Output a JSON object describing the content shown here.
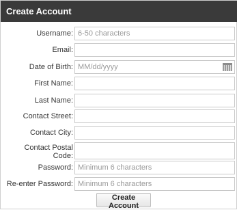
{
  "form": {
    "title": "Create Account",
    "fields": {
      "username": {
        "label": "Username:",
        "placeholder": "6-50 characters",
        "value": ""
      },
      "email": {
        "label": "Email:",
        "placeholder": "",
        "value": ""
      },
      "dob": {
        "label": "Date of Birth:",
        "placeholder": "MM/dd/yyyy",
        "value": ""
      },
      "first_name": {
        "label": "First Name:",
        "placeholder": "",
        "value": ""
      },
      "last_name": {
        "label": "Last Name:",
        "placeholder": "",
        "value": ""
      },
      "street": {
        "label": "Contact Street:",
        "placeholder": "",
        "value": ""
      },
      "city": {
        "label": "Contact City:",
        "placeholder": "",
        "value": ""
      },
      "postal": {
        "label": "Contact Postal Code:",
        "placeholder": "",
        "value": ""
      },
      "password": {
        "label": "Password:",
        "placeholder": "Minimum 6 characters",
        "value": ""
      },
      "reenter": {
        "label": "Re-enter Password:",
        "placeholder": "Minimum 6 characters",
        "value": ""
      }
    },
    "submit_label": "Create Account",
    "calendar_icon": "calendar-icon"
  }
}
